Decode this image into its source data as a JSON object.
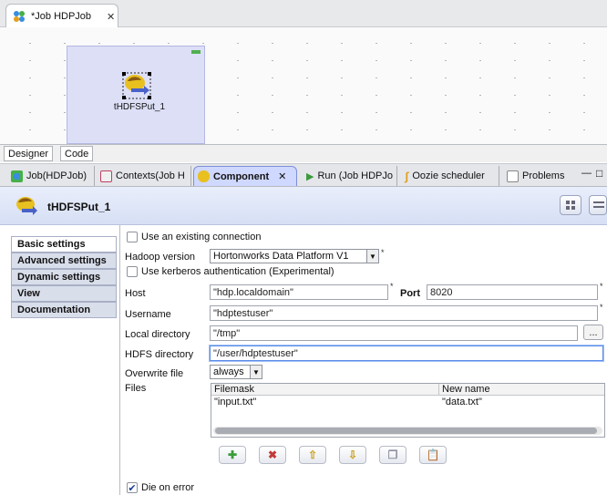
{
  "editor": {
    "tab_title": "*Job HDPJob",
    "close_glyph": "✕"
  },
  "canvas": {
    "component_label": "tHDFSPut_1"
  },
  "designer_tabs": [
    {
      "label": "Designer"
    },
    {
      "label": "Code"
    }
  ],
  "view_tabs": [
    {
      "label": "Job(HDPJob)",
      "icon": "job-icon"
    },
    {
      "label": "Contexts(Job H",
      "icon": "contexts-icon"
    },
    {
      "label": "Component",
      "icon": "component-icon",
      "close": "✕"
    },
    {
      "label": "Run (Job HDPJo",
      "icon": "run-icon"
    },
    {
      "label": "Oozie scheduler",
      "icon": "oozie-icon"
    },
    {
      "label": "Problems",
      "icon": "problems-icon"
    }
  ],
  "window_controls": {
    "minimize": "—",
    "maximize": "□"
  },
  "component": {
    "name": "tHDFSPut_1"
  },
  "left_nav": [
    {
      "label": "Basic settings"
    },
    {
      "label": "Advanced settings"
    },
    {
      "label": "Dynamic settings"
    },
    {
      "label": "View"
    },
    {
      "label": "Documentation"
    }
  ],
  "form": {
    "use_existing_connection": {
      "label": "Use an existing connection",
      "checked": false
    },
    "hadoop_version": {
      "label": "Hadoop version",
      "value": "Hortonworks Data Platform V1"
    },
    "use_kerberos": {
      "label": "Use kerberos authentication (Experimental)",
      "checked": false
    },
    "host": {
      "label": "Host",
      "value": "\"hdp.localdomain\""
    },
    "port": {
      "label": "Port",
      "value": "8020"
    },
    "username": {
      "label": "Username",
      "value": "\"hdptestuser\""
    },
    "local_directory": {
      "label": "Local directory",
      "value": "\"/tmp\"",
      "browse": "..."
    },
    "hdfs_directory": {
      "label": "HDFS directory",
      "value": "\"/user/hdptestuser\""
    },
    "overwrite_file": {
      "label": "Overwrite file",
      "value": "always"
    },
    "files": {
      "label": "Files"
    },
    "required_mark": "*",
    "die_on_error": {
      "label": "Die on error",
      "checked": true
    }
  },
  "files_table": {
    "columns": [
      "Filemask",
      "New name"
    ],
    "rows": [
      [
        "\"input.txt\"",
        "\"data.txt\""
      ]
    ]
  },
  "table_buttons": [
    "add",
    "remove",
    "move-up",
    "move-down",
    "copy",
    "paste"
  ],
  "colors": {
    "accent": "#7d8fd6",
    "selection_bg": "#dcdff6"
  }
}
